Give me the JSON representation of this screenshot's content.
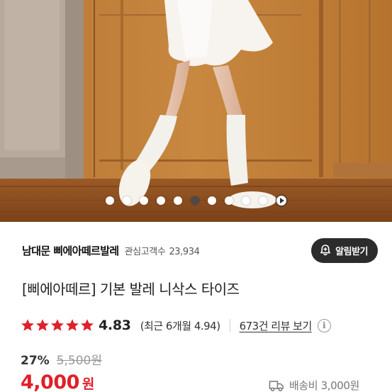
{
  "carousel": {
    "slide_count": 10,
    "active_index": 5,
    "play_icon": "play-icon"
  },
  "store": {
    "name": "남대문 삐에아떼르발레",
    "watchers_label": "관심고객수",
    "watchers_count": "23,934",
    "alarm_label": "알림받기",
    "alarm_icon": "bell-plus-icon"
  },
  "product": {
    "title": "[삐에아떼르] 기본 발레 니삭스 타이즈"
  },
  "rating": {
    "stars": 5,
    "star_color": "#e0202a",
    "value": "4.83",
    "recent": "(최근 6개월 4.94)",
    "review_link": "673건 리뷰 보기",
    "info_icon": "info-icon"
  },
  "price": {
    "discount": "27%",
    "original": "5,500원",
    "current": "4,000",
    "currency": "원",
    "color": "#e0202a"
  },
  "shipping": {
    "icon": "truck-icon",
    "text": "배송비 3,000원"
  }
}
